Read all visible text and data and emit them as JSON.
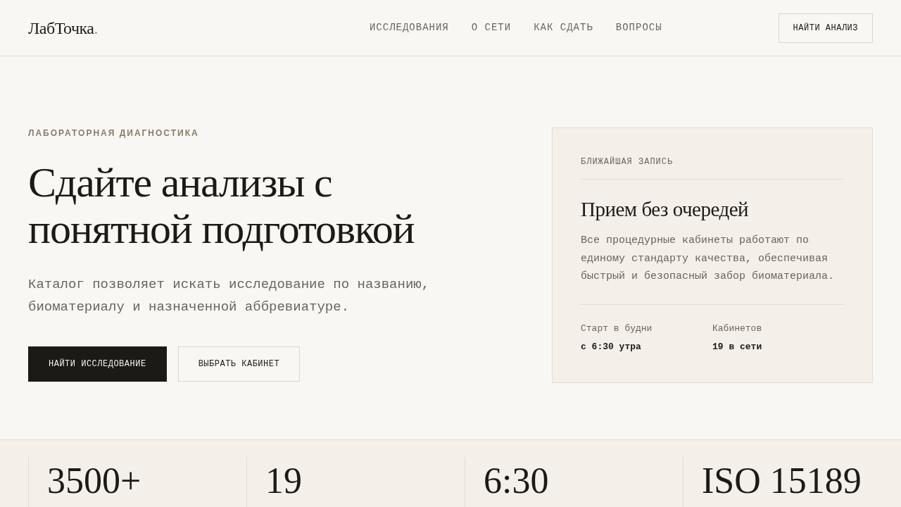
{
  "header": {
    "logo": {
      "text": "ЛабТочка",
      "mark": "."
    },
    "nav": [
      {
        "label": "ИССЛЕДОВАНИЯ"
      },
      {
        "label": "О СЕТИ"
      },
      {
        "label": "КАК СДАТЬ"
      },
      {
        "label": "ВОПРОСЫ"
      }
    ],
    "cta": "НАЙТИ АНАЛИЗ"
  },
  "hero": {
    "eyebrow": "ЛАБОРАТОРНАЯ ДИАГНОСТИКА",
    "title": "Сдайте анализы с понятной подготовкой",
    "text": "Каталог позволяет искать исследование по названию, биоматериалу и назначенной аббревиатуре.",
    "buttons": [
      {
        "label": "НАЙТИ ИССЛЕДОВАНИЕ",
        "kind": "primary"
      },
      {
        "label": "ВЫБРАТЬ КАБИНЕТ",
        "kind": "secondary"
      }
    ]
  },
  "card": {
    "eyebrow": "БЛИЖАЙШАЯ ЗАПИСЬ",
    "title": "Прием без очередей",
    "text": "Все процедурные кабинеты работают по единому стандарту качества, обеспечивая быстрый и безопасный забор биоматериала.",
    "facts": [
      {
        "label": "Старт в будни",
        "value": "с 6:30 утра"
      },
      {
        "label": "Кабинетов",
        "value": "19 в сети"
      }
    ]
  },
  "stats": [
    {
      "value": "3500+"
    },
    {
      "value": "19"
    },
    {
      "value": "6:30"
    },
    {
      "value": "ISO 15189"
    }
  ]
}
